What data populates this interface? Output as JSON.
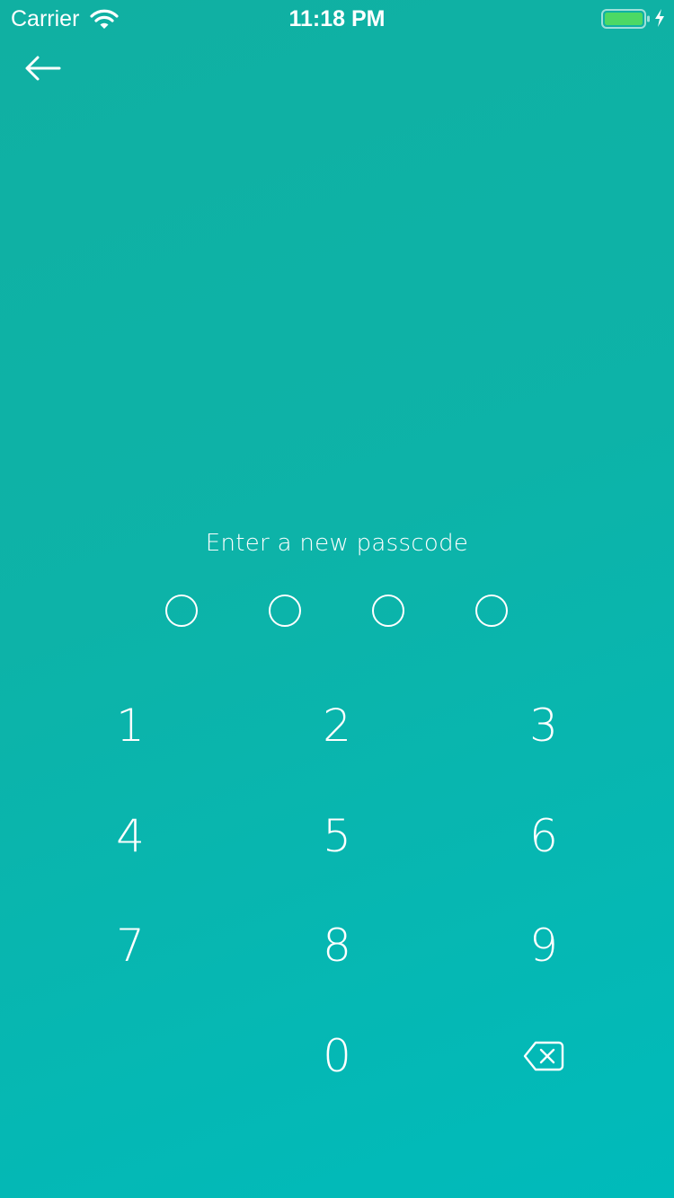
{
  "status_bar": {
    "carrier": "Carrier",
    "time": "11:18 PM",
    "battery_color": "#4cd964",
    "icons": [
      "wifi-icon",
      "battery-icon",
      "charging-icon"
    ]
  },
  "nav": {
    "back_icon": "arrow-left-icon"
  },
  "passcode": {
    "prompt": "Enter a new passcode",
    "length": 4,
    "entered": 0
  },
  "keypad": {
    "keys": [
      "1",
      "2",
      "3",
      "4",
      "5",
      "6",
      "7",
      "8",
      "9",
      "0"
    ],
    "delete_icon": "backspace-icon"
  },
  "colors": {
    "background_start": "#10b0a2",
    "background_end": "#00bbbb",
    "foreground": "#ffffff"
  }
}
